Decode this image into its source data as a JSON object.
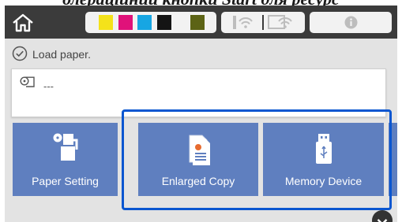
{
  "caption": "олераціиний кнопки Start для ресурс",
  "toolbar": {
    "home_icon": "home-icon",
    "ink_colors": [
      "#f4e21a",
      "#e0127a",
      "#17a6e3",
      "#141414",
      "#5c6315"
    ],
    "wifi_icon": "wifi-icon",
    "wifi_direct_icon": "wifi-direct-icon",
    "info_icon": "info-icon"
  },
  "status": {
    "icon": "check-circle-icon",
    "message": "Load paper."
  },
  "paper": {
    "icon": "paper-roll-icon",
    "value": "---"
  },
  "tiles": [
    {
      "label": "Paper Setting",
      "icon": "paper-setting-icon"
    },
    {
      "label": "Enlarged Copy",
      "icon": "enlarged-copy-icon"
    },
    {
      "label": "Memory Device",
      "icon": "memory-device-icon"
    }
  ],
  "colors": {
    "tile": "#5f7fbf",
    "highlight": "#0a56d0",
    "topbar": "#3b3b3b"
  }
}
